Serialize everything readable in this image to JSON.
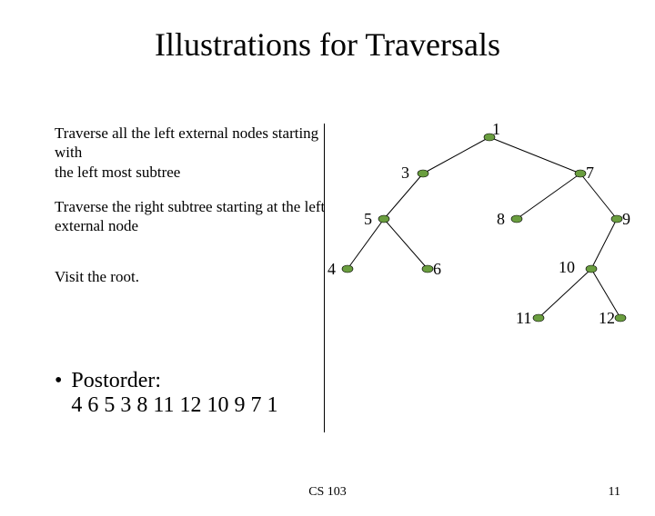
{
  "title": "Illustrations for Traversals",
  "steps": {
    "s1a": "Traverse all the left external nodes starting with",
    "s1b": " the left most subtree",
    "s2a": "Traverse the right subtree starting at the left",
    "s2b": "external node",
    "s3": "Visit the root."
  },
  "bullet": {
    "heading": "Postorder:",
    "sequence": "4 6 5 3 8 11 12 10 9 7 1"
  },
  "footer": {
    "course": "CS 103",
    "page": "11"
  },
  "tree_nodes": {
    "n1": "1",
    "n3": "3",
    "n7": "7",
    "n5": "5",
    "n8": "8",
    "n9": "9",
    "n4": "4",
    "n6": "6",
    "n10": "10",
    "n11": "11",
    "n12": "12"
  },
  "chart_data": {
    "type": "tree",
    "title": "Binary tree for postorder traversal illustration",
    "nodes": [
      1,
      3,
      7,
      5,
      8,
      9,
      4,
      6,
      10,
      11,
      12
    ],
    "edges": [
      [
        1,
        3
      ],
      [
        1,
        7
      ],
      [
        3,
        5
      ],
      [
        5,
        4
      ],
      [
        5,
        6
      ],
      [
        7,
        8
      ],
      [
        7,
        9
      ],
      [
        9,
        10
      ],
      [
        10,
        11
      ],
      [
        10,
        12
      ]
    ],
    "postorder": [
      4,
      6,
      5,
      3,
      8,
      11,
      12,
      10,
      9,
      7,
      1
    ]
  }
}
